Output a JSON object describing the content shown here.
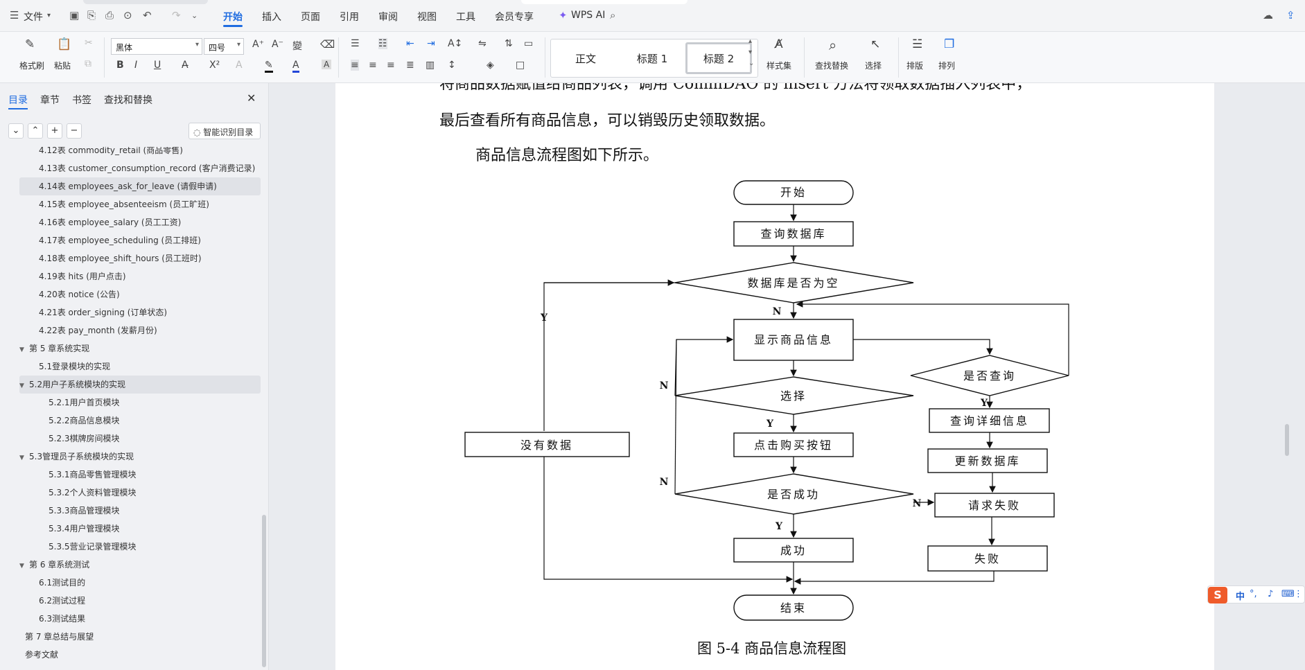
{
  "menubar": {
    "file_label": "文件",
    "tabs": [
      "开始",
      "插入",
      "页面",
      "引用",
      "审阅",
      "视图",
      "工具",
      "会员专享"
    ],
    "wps_ai": "WPS AI"
  },
  "ribbon": {
    "format_painter": "格式刷",
    "paste": "粘贴",
    "font_name": "黑体",
    "font_size": "四号",
    "styles": [
      "正文",
      "标题 1",
      "标题 2"
    ],
    "style_set": "样式集",
    "find_replace": "查找替换",
    "select": "选择",
    "layout": "排版",
    "arrange": "排列"
  },
  "nav": {
    "tabs": [
      "目录",
      "章节",
      "书签",
      "查找和替换"
    ],
    "smart_toc": "智能识别目录",
    "items": [
      {
        "text": "4.12表 commodity_retail (商品零售)",
        "level": 2
      },
      {
        "text": "4.13表 customer_consumption_record (客户消费记录)",
        "level": 2
      },
      {
        "text": "4.14表 employees_ask_for_leave (请假申请)",
        "level": 2,
        "highlight": true
      },
      {
        "text": "4.15表 employee_absenteeism (员工旷班)",
        "level": 2
      },
      {
        "text": "4.16表 employee_salary (员工工资)",
        "level": 2
      },
      {
        "text": "4.17表 employee_scheduling (员工排班)",
        "level": 2
      },
      {
        "text": "4.18表 employee_shift_hours (员工班时)",
        "level": 2
      },
      {
        "text": "4.19表 hits (用户点击)",
        "level": 2
      },
      {
        "text": "4.20表 notice (公告)",
        "level": 2
      },
      {
        "text": "4.21表 order_signing (订单状态)",
        "level": 2
      },
      {
        "text": "4.22表 pay_month (发薪月份)",
        "level": 2
      },
      {
        "text": "第 5 章系统实现",
        "level": 1,
        "expanded": true
      },
      {
        "text": "5.1登录模块的实现",
        "level": 2
      },
      {
        "text": "5.2用户子系统模块的实现",
        "level": 2,
        "expanded": true,
        "highlight": true
      },
      {
        "text": "5.2.1用户首页模块",
        "level": 3
      },
      {
        "text": "5.2.2商品信息模块",
        "level": 3
      },
      {
        "text": "5.2.3棋牌房间模块",
        "level": 3
      },
      {
        "text": "5.3管理员子系统模块的实现",
        "level": 2,
        "expanded": true
      },
      {
        "text": "5.3.1商品零售管理模块",
        "level": 3
      },
      {
        "text": "5.3.2个人资料管理模块",
        "level": 3
      },
      {
        "text": "5.3.3商品管理模块",
        "level": 3
      },
      {
        "text": "5.3.4用户管理模块",
        "level": 3
      },
      {
        "text": "5.3.5营业记录管理模块",
        "level": 3
      },
      {
        "text": "第 6 章系统测试",
        "level": 1,
        "expanded": true
      },
      {
        "text": "6.1测试目的",
        "level": 2
      },
      {
        "text": "6.2测试过程",
        "level": 2
      },
      {
        "text": "6.3测试结果",
        "level": 2
      },
      {
        "text": "第 7 章总结与展望",
        "level": 1
      },
      {
        "text": "参考文献",
        "level": 1
      }
    ]
  },
  "document": {
    "line1": "将商品数据赋值给商品列表，调用 CommDAO 的 insert 方法将领取数据插入列表中，",
    "line2": "最后查看所有商品信息，可以销毁历史领取数据。",
    "line3": "商品信息流程图如下所示。",
    "caption": "图 5-4 商品信息流程图"
  },
  "flowchart": {
    "start": "开始",
    "query_db": "查询数据库",
    "db_empty": "数据库是否为空",
    "show_info": "显示商品信息",
    "choose": "选择",
    "click_buy": "点击购买按钮",
    "success_q": "是否成功",
    "success": "成功",
    "end": "结束",
    "no_data": "没有数据",
    "is_query": "是否查询",
    "query_detail": "查询详细信息",
    "update_db": "更新数据库",
    "request_fail": "请求失败",
    "fail": "失败",
    "label_y": "Y",
    "label_n": "N"
  },
  "ime": {
    "lang": "中",
    "punct": "°,"
  },
  "colors": {
    "accent": "#1f6ce0",
    "ime_brand": "#ef5b2a"
  }
}
